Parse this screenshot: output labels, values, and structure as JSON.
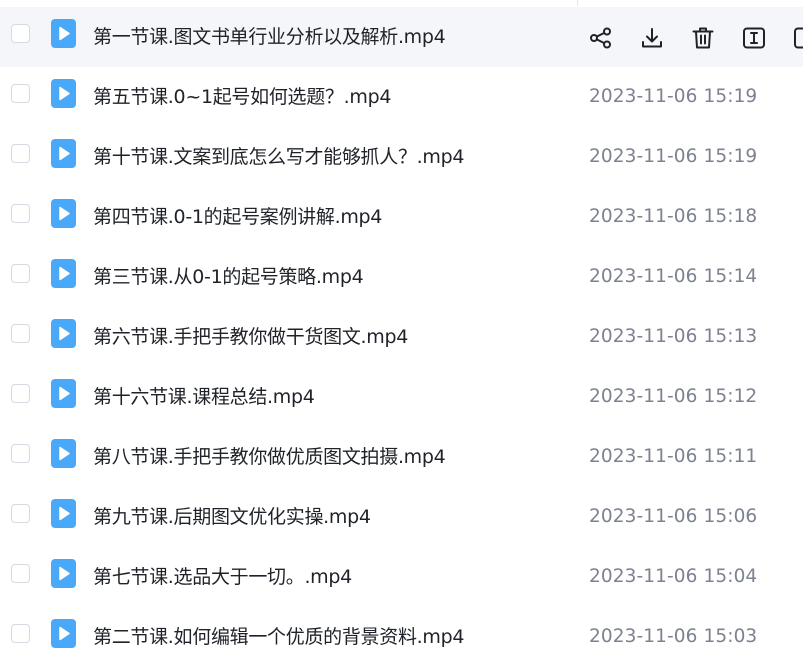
{
  "files": [
    {
      "name": "第一节课.图文书单行业分析以及解析.mp4",
      "date": "",
      "hovered": true
    },
    {
      "name": "第五节课.0~1起号如何选题？.mp4",
      "date": "2023-11-06 15:19"
    },
    {
      "name": "第十节课.文案到底怎么写才能够抓人？.mp4",
      "date": "2023-11-06 15:19"
    },
    {
      "name": "第四节课.0-1的起号案例讲解.mp4",
      "date": "2023-11-06 15:18"
    },
    {
      "name": "第三节课.从0-1的起号策略.mp4",
      "date": "2023-11-06 15:14"
    },
    {
      "name": "第六节课.手把手教你做干货图文.mp4",
      "date": "2023-11-06 15:13"
    },
    {
      "name": "第十六节课.课程总结.mp4",
      "date": "2023-11-06 15:12"
    },
    {
      "name": "第八节课.手把手教你做优质图文拍摄.mp4",
      "date": "2023-11-06 15:11"
    },
    {
      "name": "第九节课.后期图文优化实操.mp4",
      "date": "2023-11-06 15:06"
    },
    {
      "name": "第七节课.选品大于一切。.mp4",
      "date": "2023-11-06 15:04"
    },
    {
      "name": "第二节课.如何编辑一个优质的背景资料.mp4",
      "date": "2023-11-06 15:03"
    }
  ],
  "row_actions": [
    {
      "name": "share-icon"
    },
    {
      "name": "download-icon"
    },
    {
      "name": "delete-icon"
    },
    {
      "name": "rename-icon"
    },
    {
      "name": "more-icon"
    }
  ],
  "colors": {
    "video_icon": "#4aa8f8",
    "hover_row": "#f5f6fa",
    "date_text": "#7d8290",
    "name_text": "#1f2329"
  }
}
